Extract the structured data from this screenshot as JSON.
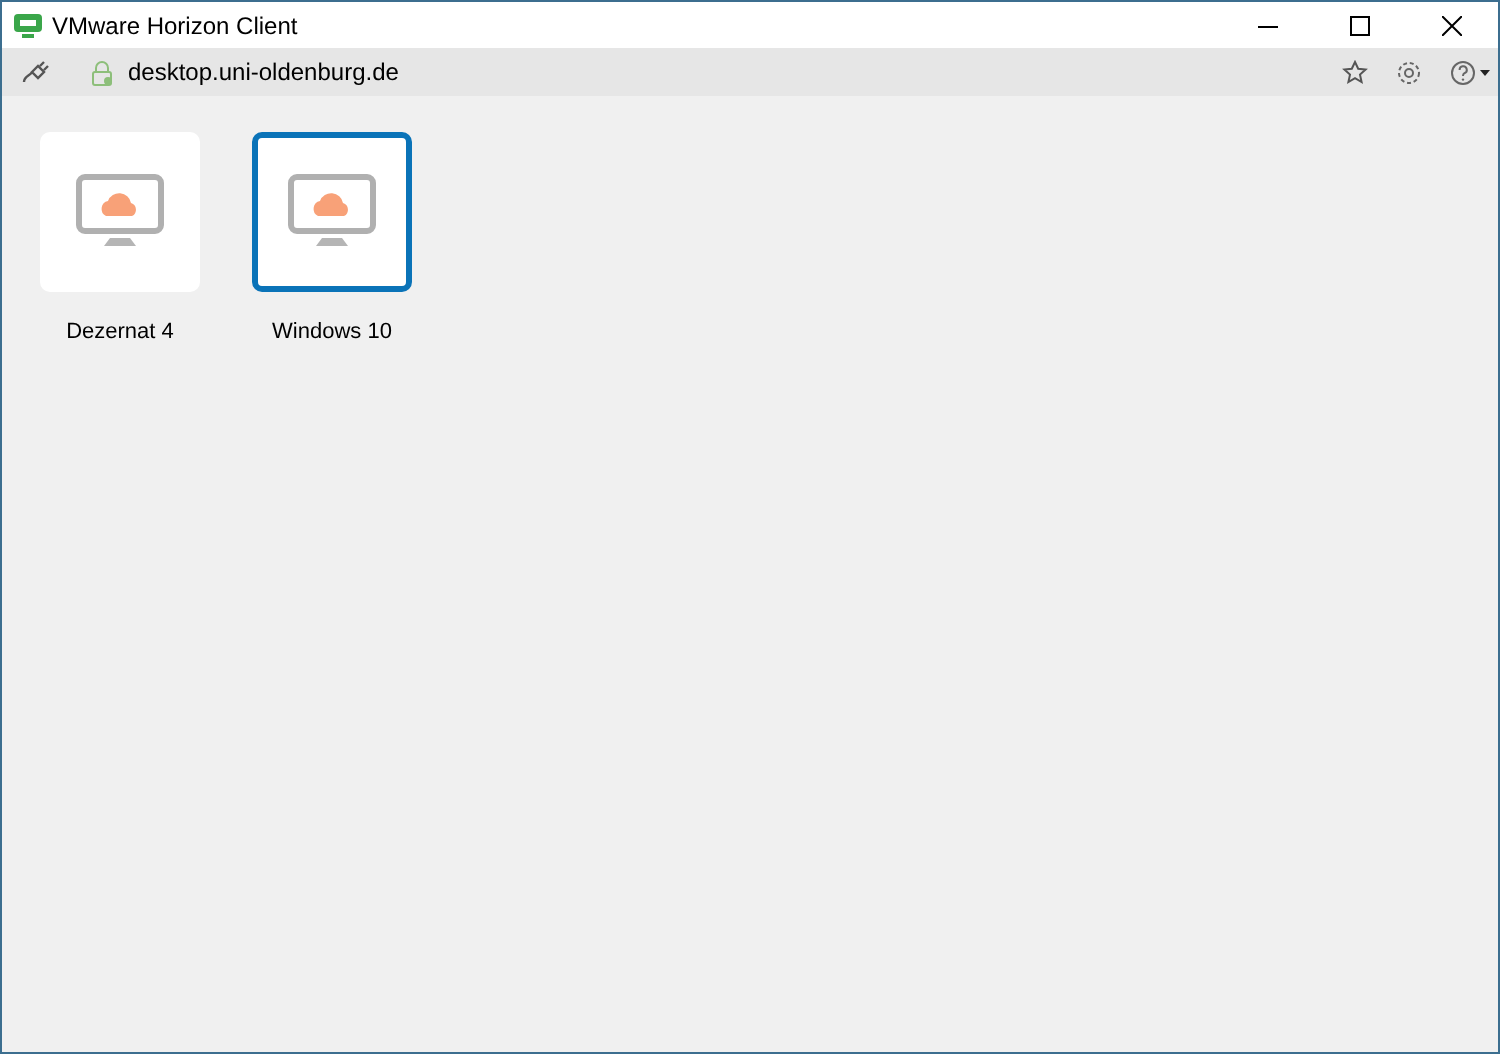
{
  "window": {
    "title": "VMware Horizon Client"
  },
  "toolbar": {
    "server": "desktop.uni-oldenburg.de"
  },
  "desktops": [
    {
      "name": "Dezernat 4",
      "selected": false
    },
    {
      "name": "Windows 10",
      "selected": true
    }
  ]
}
